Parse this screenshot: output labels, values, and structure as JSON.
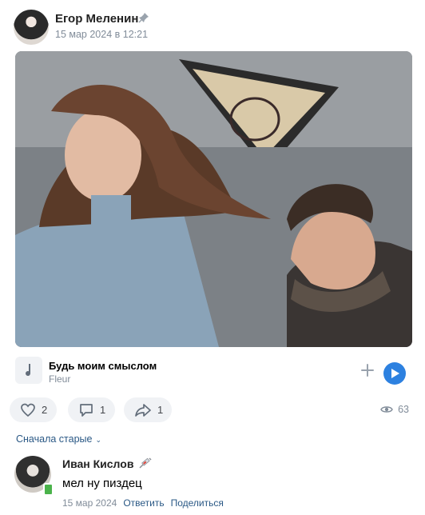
{
  "post": {
    "author": "Егор Меленин",
    "date": "15 мар 2024 в 12:21"
  },
  "audio": {
    "title": "Будь моим смыслом",
    "artist": "Fleur"
  },
  "actions": {
    "likes": "2",
    "comments": "1",
    "shares": "1",
    "views": "63"
  },
  "comments": {
    "sort_label": "Сначала старые",
    "items": [
      {
        "author": "Иван Кислов",
        "text": "мел ну пиздец",
        "date": "15 мар 2024",
        "reply_label": "Ответить",
        "share_label": "Поделиться"
      }
    ]
  },
  "colors": {
    "accent": "#2d81e0",
    "link": "#2a5885",
    "muted": "#818c99",
    "pill_bg": "#f0f2f5"
  }
}
